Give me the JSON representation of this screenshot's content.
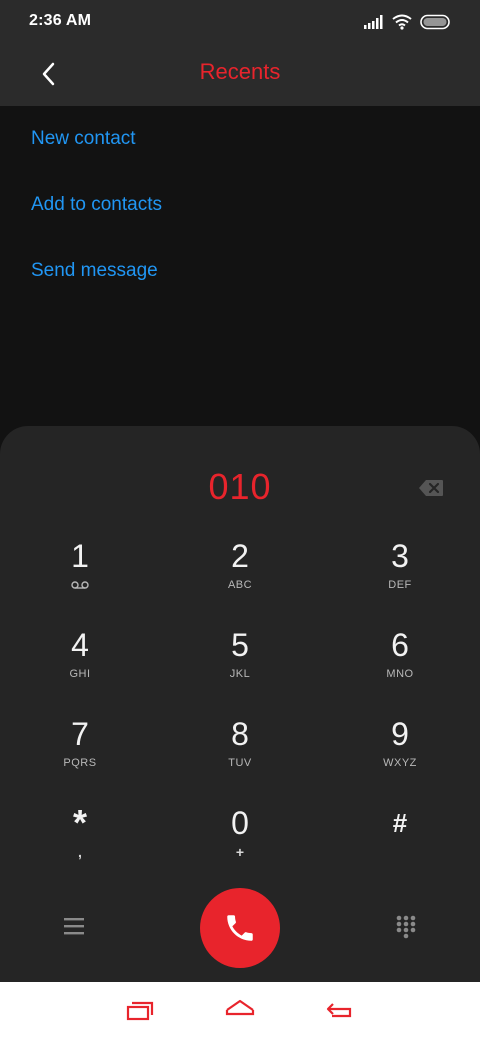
{
  "status_bar": {
    "time": "2:36 AM",
    "icons": [
      "signal-icon",
      "wifi-icon",
      "battery-icon"
    ]
  },
  "header": {
    "title": "Recents",
    "back_icon": "chevron-left-icon"
  },
  "actions": [
    {
      "label": "New contact"
    },
    {
      "label": "Add to contacts"
    },
    {
      "label": "Send message"
    }
  ],
  "dialer": {
    "number": "010",
    "keys": [
      {
        "digit": "1",
        "sub": "voicemail-icon"
      },
      {
        "digit": "2",
        "sub": "ABC"
      },
      {
        "digit": "3",
        "sub": "DEF"
      },
      {
        "digit": "4",
        "sub": "GHI"
      },
      {
        "digit": "5",
        "sub": "JKL"
      },
      {
        "digit": "6",
        "sub": "MNO"
      },
      {
        "digit": "7",
        "sub": "PQRS"
      },
      {
        "digit": "8",
        "sub": "TUV"
      },
      {
        "digit": "9",
        "sub": "WXYZ"
      },
      {
        "digit": "*",
        "sub": ","
      },
      {
        "digit": "0",
        "sub": "+"
      },
      {
        "digit": "#",
        "sub": ""
      }
    ]
  },
  "colors": {
    "accent": "#e8242c",
    "link": "#2196f3",
    "panel": "#252525",
    "background": "#121212",
    "header": "#2b2b2b"
  }
}
